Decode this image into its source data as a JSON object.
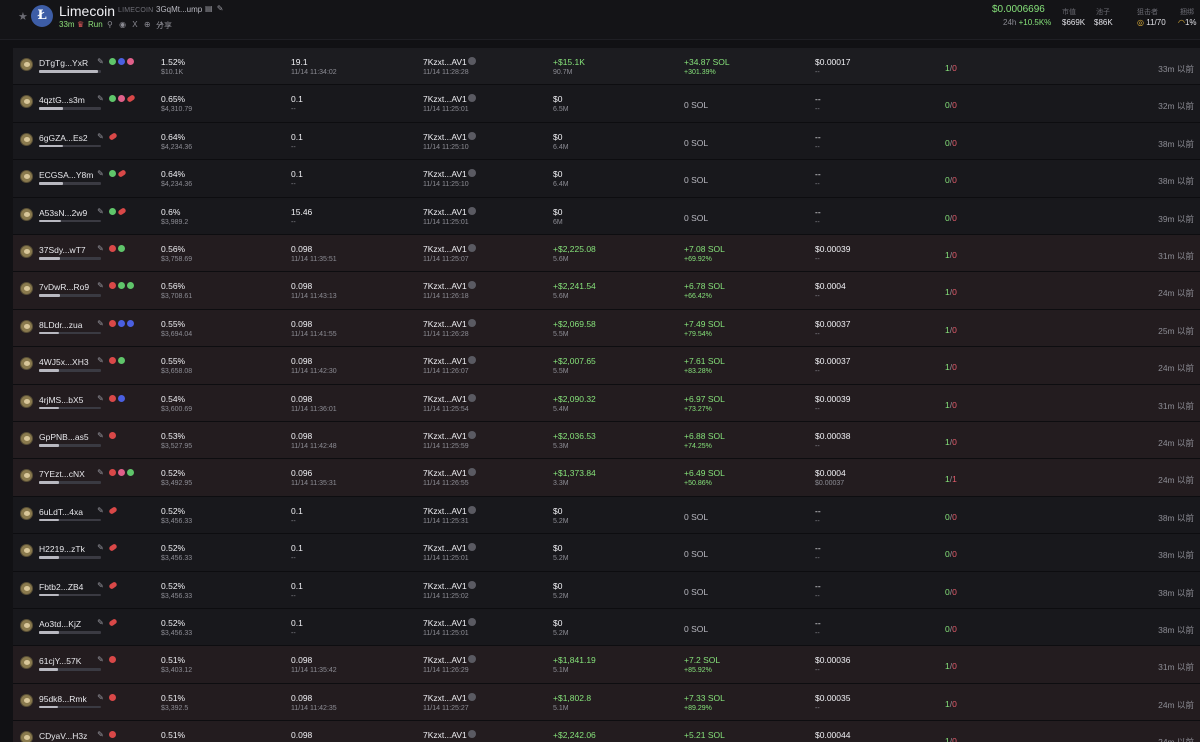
{
  "header": {
    "star_icon": "star-icon",
    "logo_letter": "Ł",
    "name": "Limecoin",
    "ticker": "LIMECOIN",
    "address": "3GqMt...ump",
    "address_icons": "▤ ✎",
    "age": "33m",
    "run_label": "Run",
    "icons": "⚲ ◉ X ⊕ ↗",
    "share": "分享",
    "price": "$0.0006696",
    "chg_label": "24h",
    "chg_value": "+10.5K%",
    "mcap_label": "市值",
    "mcap_value": "$669K",
    "pool_label": "池子",
    "pool_value": "$86K",
    "snipe_label": "狙击者",
    "snipe_value": "11/70",
    "extra_label": "捆绑",
    "extra_value": "1%"
  },
  "rows": [
    {
      "maker": "DTgTg...YxR",
      "hold": "1.52%",
      "hold_val": "$10.1K",
      "amount": "19.1",
      "amount_time": "11/14 11:34:02",
      "from": "7Kzxt...AV1",
      "from_time": "11/14 11:28:28",
      "pnl": "+$15.1K",
      "pnl_sub": "90.7M",
      "sol": "+34.87 SOL",
      "sol_sub": "+301.39%",
      "avg": "$0.00017",
      "avg_sub": "--",
      "trades_buy": "1",
      "trades_sell": "0",
      "time": "33m 以前"
    },
    {
      "maker": "4qztG...s3m",
      "hold": "0.65%",
      "hold_val": "$4,310.79",
      "amount": "0.1",
      "amount_time": "--",
      "from": "7Kzxt...AV1",
      "from_time": "11/14 11:25:01",
      "pnl": "$0",
      "pnl_sub": "6.5M",
      "sol": "0 SOL",
      "sol_sub": "",
      "avg": "--",
      "avg_sub": "--",
      "trades_buy": "0",
      "trades_sell": "0",
      "time": "32m 以前"
    },
    {
      "maker": "6gGZA...Es2",
      "hold": "0.64%",
      "hold_val": "$4,234.36",
      "amount": "0.1",
      "amount_time": "--",
      "from": "7Kzxt...AV1",
      "from_time": "11/14 11:25:10",
      "pnl": "$0",
      "pnl_sub": "6.4M",
      "sol": "0 SOL",
      "sol_sub": "",
      "avg": "--",
      "avg_sub": "--",
      "trades_buy": "0",
      "trades_sell": "0",
      "time": "38m 以前"
    },
    {
      "maker": "ECGSA...Y8m",
      "hold": "0.64%",
      "hold_val": "$4,234.36",
      "amount": "0.1",
      "amount_time": "--",
      "from": "7Kzxt...AV1",
      "from_time": "11/14 11:25:10",
      "pnl": "$0",
      "pnl_sub": "6.4M",
      "sol": "0 SOL",
      "sol_sub": "",
      "avg": "--",
      "avg_sub": "--",
      "trades_buy": "0",
      "trades_sell": "0",
      "time": "38m 以前"
    },
    {
      "maker": "A53sN...2w9",
      "hold": "0.6%",
      "hold_val": "$3,989.2",
      "amount": "15.46",
      "amount_time": "--",
      "from": "7Kzxt...AV1",
      "from_time": "11/14 11:25:01",
      "pnl": "$0",
      "pnl_sub": "6M",
      "sol": "0 SOL",
      "sol_sub": "",
      "avg": "--",
      "avg_sub": "--",
      "trades_buy": "0",
      "trades_sell": "0",
      "time": "39m 以前"
    },
    {
      "maker": "37Sdy...wT7",
      "hold": "0.56%",
      "hold_val": "$3,758.69",
      "amount": "0.098",
      "amount_time": "11/14 11:35:51",
      "from": "7Kzxt...AV1",
      "from_time": "11/14 11:25:07",
      "pnl": "+$2,225.08",
      "pnl_sub": "5.6M",
      "sol": "+7.08 SOL",
      "sol_sub": "+69.92%",
      "avg": "$0.00039",
      "avg_sub": "--",
      "trades_buy": "1",
      "trades_sell": "0",
      "time": "31m 以前"
    },
    {
      "maker": "7vDwR...Ro9",
      "hold": "0.56%",
      "hold_val": "$3,708.61",
      "amount": "0.098",
      "amount_time": "11/14 11:43:13",
      "from": "7Kzxt...AV1",
      "from_time": "11/14 11:26:18",
      "pnl": "+$2,241.54",
      "pnl_sub": "5.6M",
      "sol": "+6.78 SOL",
      "sol_sub": "+66.42%",
      "avg": "$0.0004",
      "avg_sub": "--",
      "trades_buy": "1",
      "trades_sell": "0",
      "time": "24m 以前"
    },
    {
      "maker": "8LDdr...zua",
      "hold": "0.55%",
      "hold_val": "$3,694.04",
      "amount": "0.098",
      "amount_time": "11/14 11:41:55",
      "from": "7Kzxt...AV1",
      "from_time": "11/14 11:26:28",
      "pnl": "+$2,069.58",
      "pnl_sub": "5.5M",
      "sol": "+7.49 SOL",
      "sol_sub": "+79.54%",
      "avg": "$0.00037",
      "avg_sub": "--",
      "trades_buy": "1",
      "trades_sell": "0",
      "time": "25m 以前"
    },
    {
      "maker": "4WJ5x...XH3",
      "hold": "0.55%",
      "hold_val": "$3,658.08",
      "amount": "0.098",
      "amount_time": "11/14 11:42:30",
      "from": "7Kzxt...AV1",
      "from_time": "11/14 11:26:07",
      "pnl": "+$2,007.65",
      "pnl_sub": "5.5M",
      "sol": "+7.61 SOL",
      "sol_sub": "+83.28%",
      "avg": "$0.00037",
      "avg_sub": "--",
      "trades_buy": "1",
      "trades_sell": "0",
      "time": "24m 以前"
    },
    {
      "maker": "4rjMS...bX5",
      "hold": "0.54%",
      "hold_val": "$3,600.69",
      "amount": "0.098",
      "amount_time": "11/14 11:36:01",
      "from": "7Kzxt...AV1",
      "from_time": "11/14 11:25:54",
      "pnl": "+$2,090.32",
      "pnl_sub": "5.4M",
      "sol": "+6.97 SOL",
      "sol_sub": "+73.27%",
      "avg": "$0.00039",
      "avg_sub": "--",
      "trades_buy": "1",
      "trades_sell": "0",
      "time": "31m 以前"
    },
    {
      "maker": "GpPNB...as5",
      "hold": "0.53%",
      "hold_val": "$3,527.95",
      "amount": "0.098",
      "amount_time": "11/14 11:42:48",
      "from": "7Kzxt...AV1",
      "from_time": "11/14 11:25:59",
      "pnl": "+$2,036.53",
      "pnl_sub": "5.3M",
      "sol": "+6.88 SOL",
      "sol_sub": "+74.25%",
      "avg": "$0.00038",
      "avg_sub": "--",
      "trades_buy": "1",
      "trades_sell": "0",
      "time": "24m 以前"
    },
    {
      "maker": "7YEzt...cNX",
      "hold": "0.52%",
      "hold_val": "$3,492.95",
      "amount": "0.096",
      "amount_time": "11/14 11:35:31",
      "from": "7Kzxt...AV1",
      "from_time": "11/14 11:26:55",
      "pnl": "+$1,373.84",
      "pnl_sub": "3.3M",
      "sol": "+6.49 SOL",
      "sol_sub": "+50.86%",
      "avg": "$0.0004",
      "avg_sub": "$0.00037",
      "trades_buy": "1",
      "trades_sell": "1",
      "time": "24m 以前"
    },
    {
      "maker": "6uLdT...4xa",
      "hold": "0.52%",
      "hold_val": "$3,456.33",
      "amount": "0.1",
      "amount_time": "--",
      "from": "7Kzxt...AV1",
      "from_time": "11/14 11:25:31",
      "pnl": "$0",
      "pnl_sub": "5.2M",
      "sol": "0 SOL",
      "sol_sub": "",
      "avg": "--",
      "avg_sub": "--",
      "trades_buy": "0",
      "trades_sell": "0",
      "time": "38m 以前"
    },
    {
      "maker": "H2219...zTk",
      "hold": "0.52%",
      "hold_val": "$3,456.33",
      "amount": "0.1",
      "amount_time": "--",
      "from": "7Kzxt...AV1",
      "from_time": "11/14 11:25:01",
      "pnl": "$0",
      "pnl_sub": "5.2M",
      "sol": "0 SOL",
      "sol_sub": "",
      "avg": "--",
      "avg_sub": "--",
      "trades_buy": "0",
      "trades_sell": "0",
      "time": "38m 以前"
    },
    {
      "maker": "Fbtb2...ZB4",
      "hold": "0.52%",
      "hold_val": "$3,456.33",
      "amount": "0.1",
      "amount_time": "--",
      "from": "7Kzxt...AV1",
      "from_time": "11/14 11:25:02",
      "pnl": "$0",
      "pnl_sub": "5.2M",
      "sol": "0 SOL",
      "sol_sub": "",
      "avg": "--",
      "avg_sub": "--",
      "trades_buy": "0",
      "trades_sell": "0",
      "time": "38m 以前"
    },
    {
      "maker": "Ao3td...KjZ",
      "hold": "0.52%",
      "hold_val": "$3,456.33",
      "amount": "0.1",
      "amount_time": "--",
      "from": "7Kzxt...AV1",
      "from_time": "11/14 11:25:01",
      "pnl": "$0",
      "pnl_sub": "5.2M",
      "sol": "0 SOL",
      "sol_sub": "",
      "avg": "--",
      "avg_sub": "--",
      "trades_buy": "0",
      "trades_sell": "0",
      "time": "38m 以前"
    },
    {
      "maker": "61cjY...57K",
      "hold": "0.51%",
      "hold_val": "$3,403.12",
      "amount": "0.098",
      "amount_time": "11/14 11:35:42",
      "from": "7Kzxt...AV1",
      "from_time": "11/14 11:26:29",
      "pnl": "+$1,841.19",
      "pnl_sub": "5.1M",
      "sol": "+7.2 SOL",
      "sol_sub": "+85.92%",
      "avg": "$0.00036",
      "avg_sub": "--",
      "trades_buy": "1",
      "trades_sell": "0",
      "time": "31m 以前"
    },
    {
      "maker": "95dk8...Rmk",
      "hold": "0.51%",
      "hold_val": "$3,392.5",
      "amount": "0.098",
      "amount_time": "11/14 11:42:35",
      "from": "7Kzxt...AV1",
      "from_time": "11/14 11:25:27",
      "pnl": "+$1,802.8",
      "pnl_sub": "5.1M",
      "sol": "+7.33 SOL",
      "sol_sub": "+89.29%",
      "avg": "$0.00035",
      "avg_sub": "--",
      "trades_buy": "1",
      "trades_sell": "0",
      "time": "24m 以前"
    },
    {
      "maker": "CDyaV...H3z",
      "hold": "0.51%",
      "hold_val": "",
      "amount": "0.098",
      "amount_time": "",
      "from": "7Kzxt...AV1",
      "from_time": "",
      "pnl": "+$2,242.06",
      "pnl_sub": "",
      "sol": "+5.21 SOL",
      "sol_sub": "",
      "avg": "$0.00044",
      "avg_sub": "",
      "trades_buy": "1",
      "trades_sell": "0",
      "time": "24m 以前"
    }
  ]
}
